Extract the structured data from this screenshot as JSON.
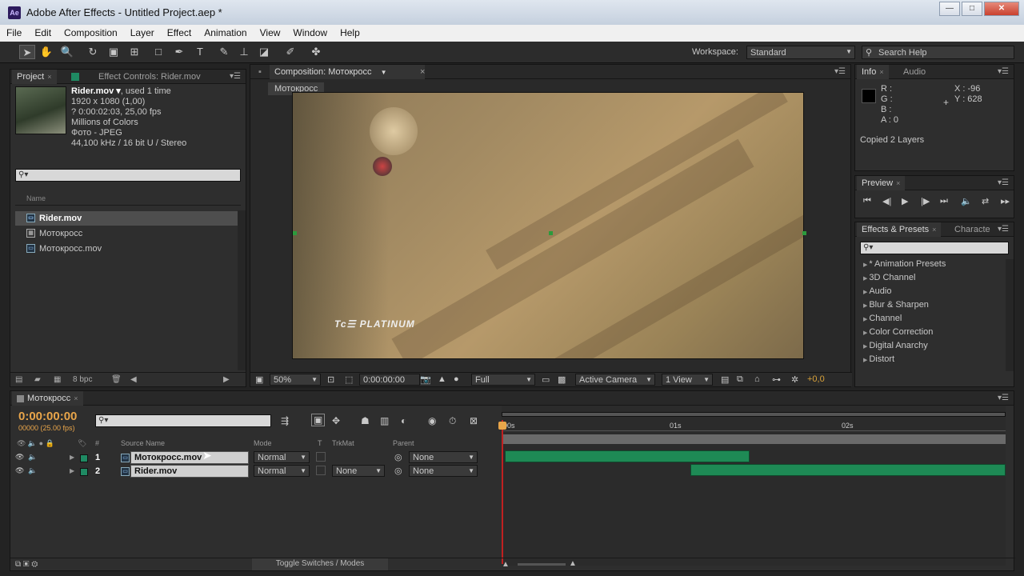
{
  "window": {
    "title": "Adobe After Effects - Untitled Project.aep *",
    "app_icon": "Ae",
    "controls": [
      "—",
      "□",
      "✕"
    ]
  },
  "menu": [
    "File",
    "Edit",
    "Composition",
    "Layer",
    "Effect",
    "Animation",
    "View",
    "Window",
    "Help"
  ],
  "toolbar": {
    "workspace_label": "Workspace:",
    "workspace_value": "Standard",
    "search_help": "Search Help"
  },
  "project": {
    "tab_project": "Project",
    "tab_effects": "Effect Controls: Rider.mov",
    "file": {
      "name": "Rider.mov ▾",
      "used": ", used 1 time",
      "lines": [
        "1920 x 1080 (1,00)",
        "? 0:00:02:03, 25,00 fps",
        "Millions of Colors",
        "Фото - JPEG",
        "44,100 kHz / 16 bit U / Stereo"
      ]
    },
    "search_placeholder": "⚲▾",
    "col_name": "Name",
    "items": [
      "Rider.mov",
      "Мотокросс",
      "Мотокросс.mov"
    ],
    "bpc": "8 bpc"
  },
  "comp": {
    "tab": "Composition: Мотокросс",
    "subtab": "Мотокросс",
    "watermark": "Tc☰ PLATINUM",
    "zoom": "50%",
    "timecode": "0:00:00:00",
    "resolution": "Full",
    "camera": "Active Camera",
    "views": "1 View",
    "exposure": "+0,0"
  },
  "info": {
    "tab_info": "Info",
    "tab_audio": "Audio",
    "r": "R :",
    "g": "G :",
    "b": "B :",
    "a": "A : 0",
    "x": "X : -96",
    "y": "Y : 628",
    "status": "Copied 2 Layers"
  },
  "preview": {
    "tab": "Preview",
    "buttons": [
      "⏮",
      "◀|",
      "▶",
      "|▶",
      "⏭",
      "🔈",
      "⇄",
      "▸▸"
    ]
  },
  "effects": {
    "tab": "Effects & Presets",
    "tab2": "Characte",
    "search_placeholder": "⚲▾",
    "items": [
      "* Animation Presets",
      "3D Channel",
      "Audio",
      "Blur & Sharpen",
      "Channel",
      "Color Correction",
      "Digital Anarchy",
      "Distort"
    ]
  },
  "timeline": {
    "tab": "Мотокросс",
    "timecode": "0:00:00:00",
    "fps": "00000 (25.00 fps)",
    "search_placeholder": "⚲▾",
    "headers": {
      "source": "Source Name",
      "mode": "Mode",
      "t": "T",
      "trkmat": "TrkMat",
      "parent": "Parent",
      "hash": "#"
    },
    "ruler": [
      "00s",
      "01s",
      "02s"
    ],
    "layers": [
      {
        "num": "1",
        "name": "Мотокросс.mov",
        "mode": "Normal",
        "trkmat": "",
        "parent": "None"
      },
      {
        "num": "2",
        "name": "Rider.mov",
        "mode": "Normal",
        "trkmat": "None",
        "parent": "None"
      }
    ],
    "toggle": "Toggle Switches / Modes"
  },
  "colors": {
    "accent_timecode": "#e8a54a",
    "layer_bar": "#1e8a55",
    "cti": "#c02020"
  }
}
